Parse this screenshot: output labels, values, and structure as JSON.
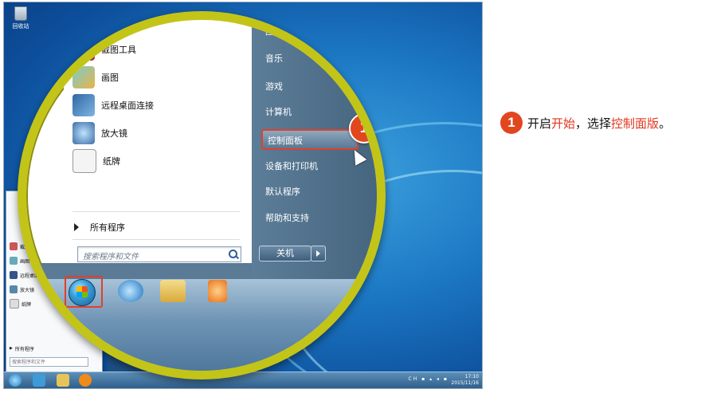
{
  "desktop": {
    "recycle_bin": "回收站",
    "small_start_menu": {
      "items": [
        "截图工具",
        "画图",
        "远程桌面连接",
        "放大镜",
        "纸牌"
      ],
      "all_programs": "所有程序",
      "search_placeholder": "搜索程序和文件"
    },
    "clock": {
      "time": "17:10",
      "date": "2015/11/16"
    },
    "tray_lang": "CH"
  },
  "magnified": {
    "left_items": [
      "截图工具",
      "画图",
      "远程桌面连接",
      "放大镜",
      "纸牌"
    ],
    "all_programs": "所有程序",
    "search_placeholder": "搜索程序和文件",
    "right_items": [
      "图片",
      "音乐",
      "游戏",
      "计算机",
      "控制面板",
      "设备和打印机",
      "默认程序",
      "帮助和支持"
    ],
    "shutdown": "关机",
    "badge": "1"
  },
  "instruction": {
    "badge": "1",
    "p1": "开启",
    "hl1": "开始",
    "p2": "，选择",
    "hl2": "控制面版",
    "p3": "。"
  },
  "colors": {
    "accent": "#e2461f",
    "lens_ring": "#c3c418"
  }
}
